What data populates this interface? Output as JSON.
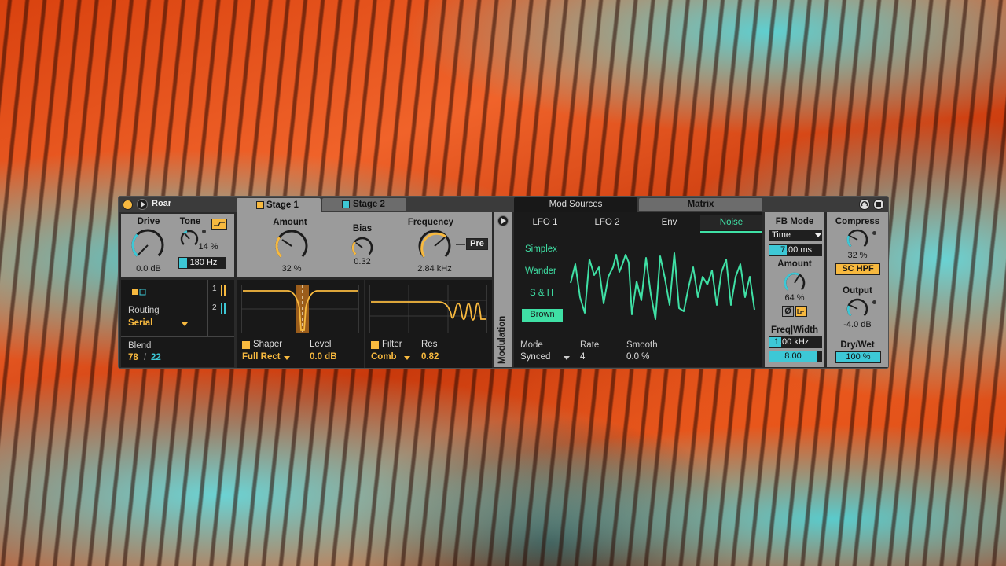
{
  "device": {
    "name": "Roar"
  },
  "colors": {
    "accent_yellow": "#f7b93f",
    "accent_cyan": "#3dc8d6",
    "mod_green": "#3fe0a5",
    "panel_grey": "#9b9b9b"
  },
  "drive": {
    "label": "Drive",
    "value": "0.0 dB"
  },
  "tone": {
    "label": "Tone",
    "value": "14 %",
    "freq_value": "180 Hz"
  },
  "routing": {
    "label": "Routing",
    "value": "Serial",
    "lane_1": "1",
    "lane_2": "2"
  },
  "blend": {
    "label": "Blend",
    "value_a": "78",
    "sep": "/",
    "value_b": "22"
  },
  "tabs": {
    "stage1": "Stage 1",
    "stage2": "Stage 2",
    "mod_sources": "Mod Sources",
    "matrix": "Matrix"
  },
  "stage": {
    "amount": {
      "label": "Amount",
      "value": "32 %"
    },
    "bias": {
      "label": "Bias",
      "value": "0.32"
    },
    "frequency": {
      "label": "Frequency",
      "value": "2.84 kHz"
    },
    "pre_label": "Pre",
    "shaper": {
      "label": "Shaper",
      "value": "Full Rect"
    },
    "level": {
      "label": "Level",
      "value": "0.0 dB"
    },
    "filter": {
      "label": "Filter",
      "value": "Comb"
    },
    "res": {
      "label": "Res",
      "value": "0.82"
    }
  },
  "modulation": {
    "vertical_label": "Modulation",
    "source_tabs": [
      "LFO 1",
      "LFO 2",
      "Env",
      "Noise"
    ],
    "noise_types": [
      "Simplex",
      "Wander",
      "S & H",
      "Brown"
    ],
    "selected_noise_type": "Brown",
    "mode": {
      "label": "Mode",
      "value": "Synced"
    },
    "rate": {
      "label": "Rate",
      "value": "4"
    },
    "smooth": {
      "label": "Smooth",
      "value": "0.0 %"
    }
  },
  "feedback": {
    "label": "FB Mode",
    "mode_value": "Time",
    "time_value_int": "7",
    "time_value_rest": ".00 ms",
    "amount": {
      "label": "Amount",
      "value": "64 %"
    },
    "phase_label": "Ø",
    "freq_width": {
      "label": "Freq|Width",
      "freq_int": "1",
      "freq_rest": ".00 kHz",
      "width_value": "8.00"
    }
  },
  "output_section": {
    "compress": {
      "label": "Compress",
      "value": "32 %",
      "sc_label": "SC HPF"
    },
    "output": {
      "label": "Output",
      "value": "-4.0 dB"
    },
    "drywet": {
      "label": "Dry/Wet",
      "value": "100 %"
    }
  }
}
